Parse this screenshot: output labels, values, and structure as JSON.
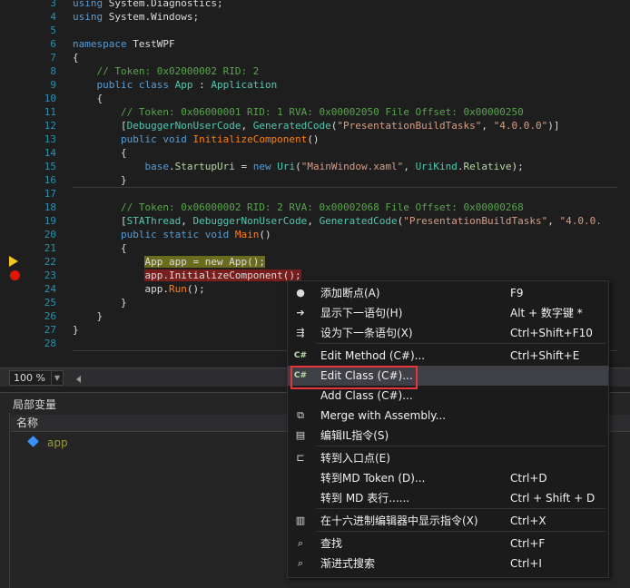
{
  "editor": {
    "lines": [
      {
        "n": "3",
        "tokens": [
          [
            "kw",
            "using "
          ],
          [
            "pl",
            "System.Diagnostics;"
          ]
        ]
      },
      {
        "n": "4",
        "tokens": [
          [
            "kw",
            "using "
          ],
          [
            "pl",
            "System.Windows;"
          ]
        ]
      },
      {
        "n": "5",
        "tokens": []
      },
      {
        "n": "6",
        "tokens": [
          [
            "kw",
            "namespace "
          ],
          [
            "pl",
            "TestWPF"
          ]
        ]
      },
      {
        "n": "7",
        "tokens": [
          [
            "pl",
            "{"
          ]
        ]
      },
      {
        "n": "8",
        "tokens": [
          [
            "pl",
            "    "
          ],
          [
            "cm",
            "// Token: 0x02000002 RID: 2"
          ]
        ]
      },
      {
        "n": "9",
        "tokens": [
          [
            "pl",
            "    "
          ],
          [
            "kw",
            "public class "
          ],
          [
            "ty",
            "App"
          ],
          [
            "pl",
            " : "
          ],
          [
            "ty",
            "Application"
          ]
        ]
      },
      {
        "n": "10",
        "tokens": [
          [
            "pl",
            "    {"
          ]
        ]
      },
      {
        "n": "11",
        "tokens": [
          [
            "pl",
            "        "
          ],
          [
            "cm",
            "// Token: 0x06000001 RID: 1 RVA: 0x00002050 File Offset: 0x00000250"
          ]
        ]
      },
      {
        "n": "12",
        "tokens": [
          [
            "pl",
            "        ["
          ],
          [
            "ty",
            "DebuggerNonUserCode"
          ],
          [
            "pl",
            ", "
          ],
          [
            "ty",
            "GeneratedCode"
          ],
          [
            "pl",
            "("
          ],
          [
            "st",
            "\"PresentationBuildTasks\""
          ],
          [
            "pl",
            ", "
          ],
          [
            "st",
            "\"4.0.0.0\""
          ],
          [
            "pl",
            ")]"
          ]
        ]
      },
      {
        "n": "13",
        "tokens": [
          [
            "pl",
            "        "
          ],
          [
            "kw",
            "public void "
          ],
          [
            "mt",
            "InitializeComponent"
          ],
          [
            "pl",
            "()"
          ]
        ]
      },
      {
        "n": "14",
        "tokens": [
          [
            "pl",
            "        {"
          ]
        ]
      },
      {
        "n": "15",
        "tokens": [
          [
            "pl",
            "            "
          ],
          [
            "kw",
            "base"
          ],
          [
            "pl",
            "."
          ],
          [
            "pr",
            "StartupUri"
          ],
          [
            "pl",
            " = "
          ],
          [
            "kw",
            "new "
          ],
          [
            "ty",
            "Uri"
          ],
          [
            "pl",
            "("
          ],
          [
            "st",
            "\"MainWindow.xaml\""
          ],
          [
            "pl",
            ", "
          ],
          [
            "ty",
            "UriKind"
          ],
          [
            "pl",
            "."
          ],
          [
            "pr",
            "Relative"
          ],
          [
            "pl",
            ");"
          ]
        ]
      },
      {
        "n": "16",
        "tokens": [
          [
            "pl",
            "        }"
          ]
        ]
      },
      {
        "n": "17",
        "tokens": []
      },
      {
        "n": "18",
        "tokens": [
          [
            "pl",
            "        "
          ],
          [
            "cm",
            "// Token: 0x06000002 RID: 2 RVA: 0x00002068 File Offset: 0x00000268"
          ]
        ]
      },
      {
        "n": "19",
        "tokens": [
          [
            "pl",
            "        ["
          ],
          [
            "ty",
            "STAThread"
          ],
          [
            "pl",
            ", "
          ],
          [
            "ty",
            "DebuggerNonUserCode"
          ],
          [
            "pl",
            ", "
          ],
          [
            "ty",
            "GeneratedCode"
          ],
          [
            "pl",
            "("
          ],
          [
            "st",
            "\"PresentationBuildTasks\""
          ],
          [
            "pl",
            ", "
          ],
          [
            "st",
            "\"4.0.0."
          ]
        ]
      },
      {
        "n": "20",
        "tokens": [
          [
            "pl",
            "        "
          ],
          [
            "kw",
            "public static void "
          ],
          [
            "mt",
            "Main"
          ],
          [
            "pl",
            "()"
          ]
        ]
      },
      {
        "n": "21",
        "tokens": [
          [
            "pl",
            "        {"
          ]
        ]
      },
      {
        "n": "22",
        "tokens": [
          [
            "pl",
            "            "
          ],
          [
            "hy",
            "App app = new App();"
          ]
        ]
      },
      {
        "n": "23",
        "tokens": [
          [
            "pl",
            "            "
          ],
          [
            "hr",
            "app.InitializeComponent();"
          ]
        ]
      },
      {
        "n": "24",
        "tokens": [
          [
            "pl",
            "            "
          ],
          [
            "pl",
            "app."
          ],
          [
            "mt",
            "Run"
          ],
          [
            "pl",
            "();"
          ]
        ]
      },
      {
        "n": "25",
        "tokens": [
          [
            "pl",
            "        }"
          ]
        ]
      },
      {
        "n": "26",
        "tokens": [
          [
            "pl",
            "    }"
          ]
        ]
      },
      {
        "n": "27",
        "tokens": [
          [
            "pl",
            "}"
          ]
        ]
      },
      {
        "n": "28",
        "tokens": []
      }
    ]
  },
  "zoom": {
    "value": "100 %"
  },
  "locals": {
    "title": "局部变量",
    "column_name": "名称",
    "rows": [
      {
        "name": "app"
      }
    ]
  },
  "context_menu": {
    "items": [
      {
        "icon": "●",
        "label": "添加断点(A)",
        "shortcut": "F9"
      },
      {
        "icon": "➔",
        "label": "显示下一语句(H)",
        "shortcut": "Alt + 数字键 *"
      },
      {
        "icon": "⇶",
        "label": "设为下一条语句(X)",
        "shortcut": "Ctrl+Shift+F10"
      },
      {
        "icon": "C#",
        "label": "Edit Method (C#)...",
        "shortcut": "Ctrl+Shift+E"
      },
      {
        "icon": "C#",
        "label": "Edit Class (C#)...",
        "shortcut": ""
      },
      {
        "icon": "",
        "label": "Add Class (C#)...",
        "shortcut": ""
      },
      {
        "icon": "⧉",
        "label": "Merge with Assembly...",
        "shortcut": ""
      },
      {
        "icon": "▤",
        "label": "编辑IL指令(S)",
        "shortcut": ""
      },
      {
        "icon": "⊏",
        "label": "转到入口点(E)",
        "shortcut": ""
      },
      {
        "icon": "",
        "label": "转到MD Token (D)...",
        "shortcut": "Ctrl+D"
      },
      {
        "icon": "",
        "label": "转到 MD 表行......",
        "shortcut": "Ctrl + Shift + D"
      },
      {
        "icon": "▥",
        "label": "在十六进制编辑器中显示指令(X)",
        "shortcut": "Ctrl+X"
      },
      {
        "icon": "⌕",
        "label": "查找",
        "shortcut": "Ctrl+F"
      },
      {
        "icon": "⌕",
        "label": "渐进式搜索",
        "shortcut": "Ctrl+I"
      }
    ]
  }
}
